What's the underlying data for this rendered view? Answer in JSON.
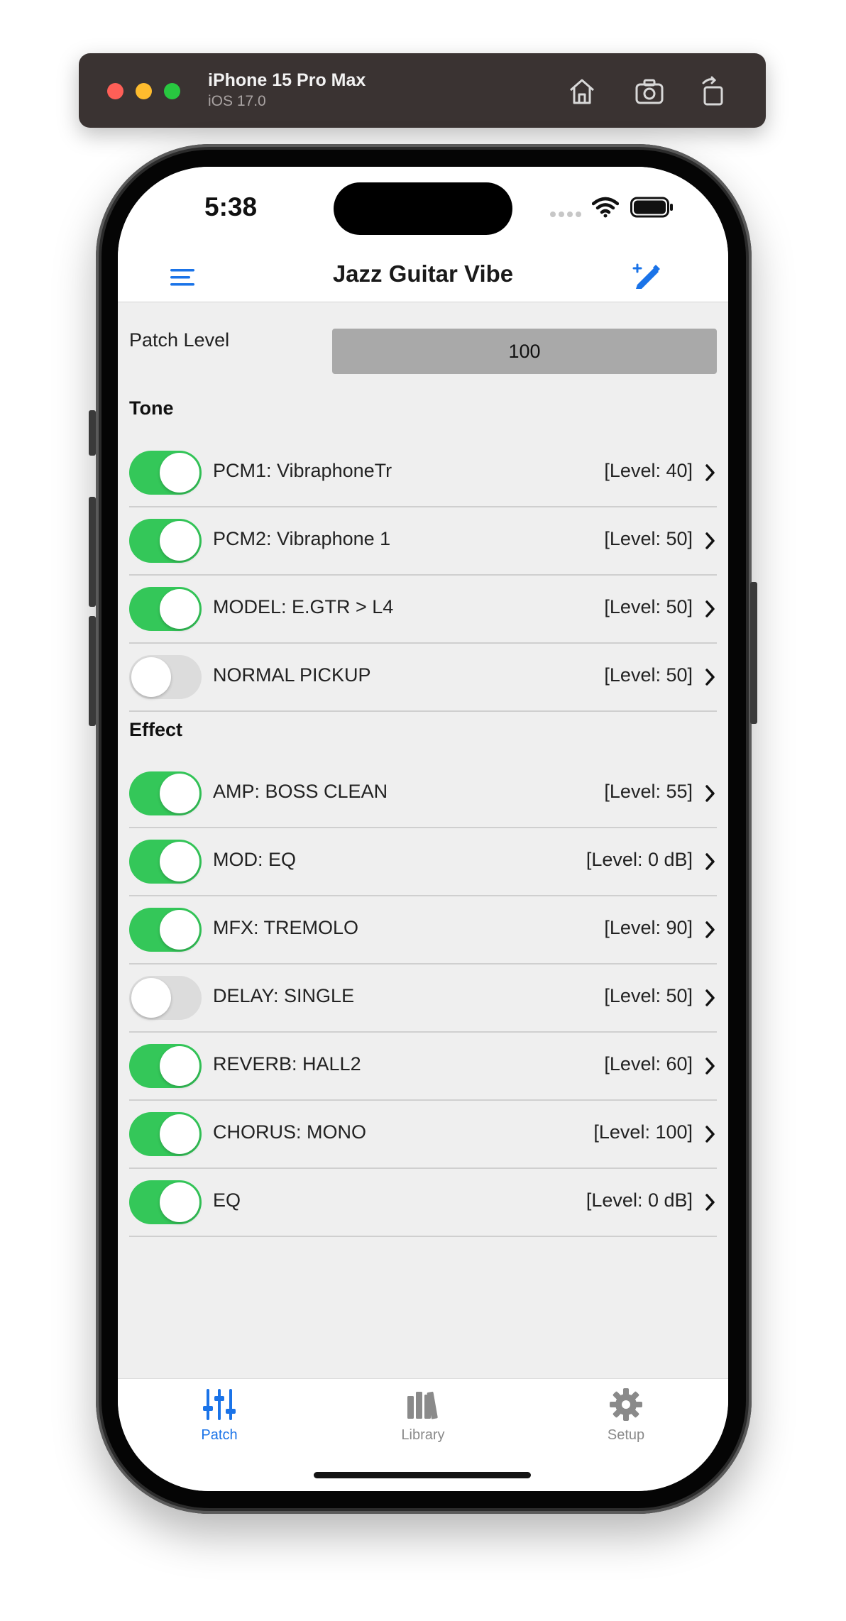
{
  "simulator": {
    "device_name": "iPhone 15 Pro Max",
    "os_version": "iOS 17.0",
    "icons": [
      "home-icon",
      "screenshot-icon",
      "rotate-icon"
    ]
  },
  "status_bar": {
    "time": "5:38",
    "icons": [
      "cellular-icon",
      "wifi-icon",
      "battery-icon"
    ]
  },
  "nav": {
    "title": "Jazz Guitar Vibe",
    "left_icon": "menu-icon",
    "right_icon": "edit-wand-icon"
  },
  "patch_level": {
    "label": "Patch Level",
    "value": "100"
  },
  "sections": {
    "tone": {
      "title": "Tone",
      "rows": [
        {
          "name": "PCM1: VibraphoneTr",
          "level": "[Level: 40]",
          "enabled": true
        },
        {
          "name": "PCM2: Vibraphone 1",
          "level": "[Level: 50]",
          "enabled": true
        },
        {
          "name": "MODEL: E.GTR > L4",
          "level": "[Level: 50]",
          "enabled": true
        },
        {
          "name": "NORMAL PICKUP",
          "level": "[Level: 50]",
          "enabled": false
        }
      ]
    },
    "effect": {
      "title": "Effect",
      "rows": [
        {
          "name": "AMP: BOSS CLEAN",
          "level": "[Level: 55]",
          "enabled": true
        },
        {
          "name": "MOD: EQ",
          "level": "[Level: 0 dB]",
          "enabled": true
        },
        {
          "name": "MFX: TREMOLO",
          "level": "[Level: 90]",
          "enabled": true
        },
        {
          "name": "DELAY: SINGLE",
          "level": "[Level: 50]",
          "enabled": false
        },
        {
          "name": "REVERB: HALL2",
          "level": "[Level: 60]",
          "enabled": true
        },
        {
          "name": "CHORUS: MONO",
          "level": "[Level: 100]",
          "enabled": true
        },
        {
          "name": "EQ",
          "level": "[Level: 0 dB]",
          "enabled": true
        }
      ]
    }
  },
  "tabs": [
    {
      "label": "Patch",
      "icon": "sliders-icon",
      "selected": true
    },
    {
      "label": "Library",
      "icon": "library-icon",
      "selected": false
    },
    {
      "label": "Setup",
      "icon": "gear-icon",
      "selected": false
    }
  ],
  "colors": {
    "accent": "#1a73e8",
    "toggle_on": "#34c759",
    "toggle_off": "#dcdcdc",
    "tab_inactive": "#8a8a8a",
    "background": "#efefef"
  }
}
